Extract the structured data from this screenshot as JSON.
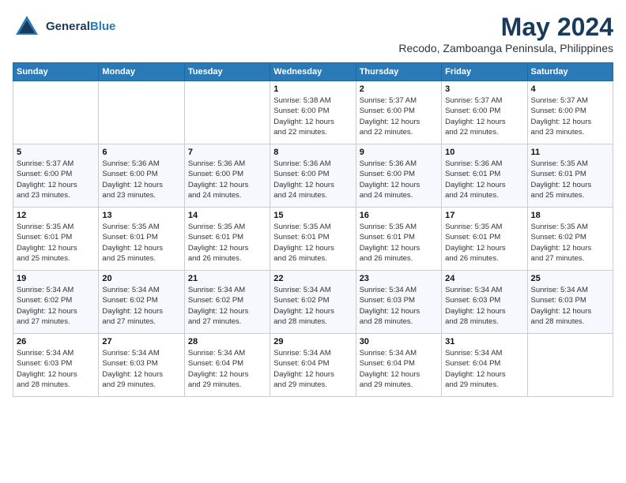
{
  "header": {
    "logo_line1": "General",
    "logo_line2": "Blue",
    "month": "May 2024",
    "location": "Recodo, Zamboanga Peninsula, Philippines"
  },
  "weekdays": [
    "Sunday",
    "Monday",
    "Tuesday",
    "Wednesday",
    "Thursday",
    "Friday",
    "Saturday"
  ],
  "weeks": [
    [
      {
        "day": "",
        "info": ""
      },
      {
        "day": "",
        "info": ""
      },
      {
        "day": "",
        "info": ""
      },
      {
        "day": "1",
        "info": "Sunrise: 5:38 AM\nSunset: 6:00 PM\nDaylight: 12 hours\nand 22 minutes."
      },
      {
        "day": "2",
        "info": "Sunrise: 5:37 AM\nSunset: 6:00 PM\nDaylight: 12 hours\nand 22 minutes."
      },
      {
        "day": "3",
        "info": "Sunrise: 5:37 AM\nSunset: 6:00 PM\nDaylight: 12 hours\nand 22 minutes."
      },
      {
        "day": "4",
        "info": "Sunrise: 5:37 AM\nSunset: 6:00 PM\nDaylight: 12 hours\nand 23 minutes."
      }
    ],
    [
      {
        "day": "5",
        "info": "Sunrise: 5:37 AM\nSunset: 6:00 PM\nDaylight: 12 hours\nand 23 minutes."
      },
      {
        "day": "6",
        "info": "Sunrise: 5:36 AM\nSunset: 6:00 PM\nDaylight: 12 hours\nand 23 minutes."
      },
      {
        "day": "7",
        "info": "Sunrise: 5:36 AM\nSunset: 6:00 PM\nDaylight: 12 hours\nand 24 minutes."
      },
      {
        "day": "8",
        "info": "Sunrise: 5:36 AM\nSunset: 6:00 PM\nDaylight: 12 hours\nand 24 minutes."
      },
      {
        "day": "9",
        "info": "Sunrise: 5:36 AM\nSunset: 6:00 PM\nDaylight: 12 hours\nand 24 minutes."
      },
      {
        "day": "10",
        "info": "Sunrise: 5:36 AM\nSunset: 6:01 PM\nDaylight: 12 hours\nand 24 minutes."
      },
      {
        "day": "11",
        "info": "Sunrise: 5:35 AM\nSunset: 6:01 PM\nDaylight: 12 hours\nand 25 minutes."
      }
    ],
    [
      {
        "day": "12",
        "info": "Sunrise: 5:35 AM\nSunset: 6:01 PM\nDaylight: 12 hours\nand 25 minutes."
      },
      {
        "day": "13",
        "info": "Sunrise: 5:35 AM\nSunset: 6:01 PM\nDaylight: 12 hours\nand 25 minutes."
      },
      {
        "day": "14",
        "info": "Sunrise: 5:35 AM\nSunset: 6:01 PM\nDaylight: 12 hours\nand 26 minutes."
      },
      {
        "day": "15",
        "info": "Sunrise: 5:35 AM\nSunset: 6:01 PM\nDaylight: 12 hours\nand 26 minutes."
      },
      {
        "day": "16",
        "info": "Sunrise: 5:35 AM\nSunset: 6:01 PM\nDaylight: 12 hours\nand 26 minutes."
      },
      {
        "day": "17",
        "info": "Sunrise: 5:35 AM\nSunset: 6:01 PM\nDaylight: 12 hours\nand 26 minutes."
      },
      {
        "day": "18",
        "info": "Sunrise: 5:35 AM\nSunset: 6:02 PM\nDaylight: 12 hours\nand 27 minutes."
      }
    ],
    [
      {
        "day": "19",
        "info": "Sunrise: 5:34 AM\nSunset: 6:02 PM\nDaylight: 12 hours\nand 27 minutes."
      },
      {
        "day": "20",
        "info": "Sunrise: 5:34 AM\nSunset: 6:02 PM\nDaylight: 12 hours\nand 27 minutes."
      },
      {
        "day": "21",
        "info": "Sunrise: 5:34 AM\nSunset: 6:02 PM\nDaylight: 12 hours\nand 27 minutes."
      },
      {
        "day": "22",
        "info": "Sunrise: 5:34 AM\nSunset: 6:02 PM\nDaylight: 12 hours\nand 28 minutes."
      },
      {
        "day": "23",
        "info": "Sunrise: 5:34 AM\nSunset: 6:03 PM\nDaylight: 12 hours\nand 28 minutes."
      },
      {
        "day": "24",
        "info": "Sunrise: 5:34 AM\nSunset: 6:03 PM\nDaylight: 12 hours\nand 28 minutes."
      },
      {
        "day": "25",
        "info": "Sunrise: 5:34 AM\nSunset: 6:03 PM\nDaylight: 12 hours\nand 28 minutes."
      }
    ],
    [
      {
        "day": "26",
        "info": "Sunrise: 5:34 AM\nSunset: 6:03 PM\nDaylight: 12 hours\nand 28 minutes."
      },
      {
        "day": "27",
        "info": "Sunrise: 5:34 AM\nSunset: 6:03 PM\nDaylight: 12 hours\nand 29 minutes."
      },
      {
        "day": "28",
        "info": "Sunrise: 5:34 AM\nSunset: 6:04 PM\nDaylight: 12 hours\nand 29 minutes."
      },
      {
        "day": "29",
        "info": "Sunrise: 5:34 AM\nSunset: 6:04 PM\nDaylight: 12 hours\nand 29 minutes."
      },
      {
        "day": "30",
        "info": "Sunrise: 5:34 AM\nSunset: 6:04 PM\nDaylight: 12 hours\nand 29 minutes."
      },
      {
        "day": "31",
        "info": "Sunrise: 5:34 AM\nSunset: 6:04 PM\nDaylight: 12 hours\nand 29 minutes."
      },
      {
        "day": "",
        "info": ""
      }
    ]
  ]
}
